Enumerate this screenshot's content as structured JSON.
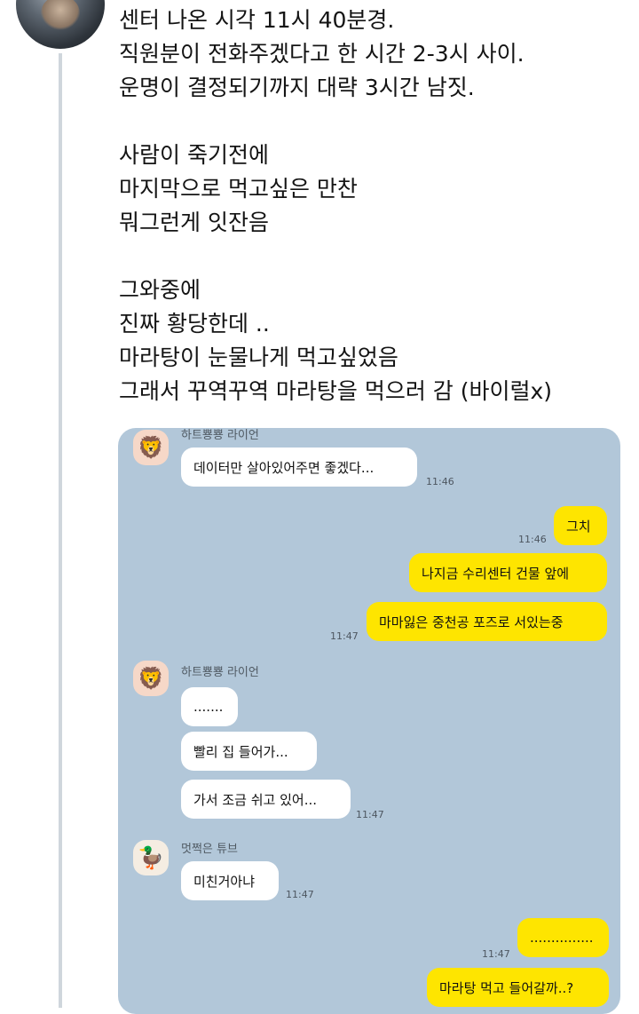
{
  "tweet": {
    "lines": [
      "센터 나온 시각 11시 40분경.",
      "직원분이 전화주겠다고 한 시간 2-3시 사이.",
      "운명이 결정되기까지 대략 3시간 남짓.",
      "",
      "사람이 죽기전에",
      "마지막으로 먹고싶은 만찬",
      "뭐그런게 잇잔음",
      "",
      "그와중에",
      "진짜 황당한데 ..",
      "마라탕이 눈물나게 먹고싶었음",
      "그래서 꾸역꾸역 마라탕을 먹으러 감 (바이럴x)"
    ]
  },
  "chat": {
    "messages": [
      {
        "sender": "하트뿅뿅 라이언",
        "text": "데이터만 살아있어주면 좋겠다...",
        "time": "11:46"
      },
      {
        "text": "그치",
        "time": "11:46"
      },
      {
        "text": "나지금 수리센터 건물 앞에"
      },
      {
        "text": "마마잃은 중천공 포즈로 서있는중",
        "time": "11:47"
      },
      {
        "sender": "하트뿅뿅 라이언",
        "text": "......."
      },
      {
        "text": "빨리 집 들어가..."
      },
      {
        "text": "가서 조금 쉬고 있어...",
        "time": "11:47"
      },
      {
        "sender": "멋쩍은 튜브",
        "text": "미친거아냐",
        "time": "11:47"
      },
      {
        "text": "...............",
        "time": "11:47"
      },
      {
        "text": "마라탕 먹고 들어갈까..?"
      }
    ],
    "icons": {
      "ryan": "lion-character-icon",
      "tube": "duck-character-icon"
    }
  }
}
